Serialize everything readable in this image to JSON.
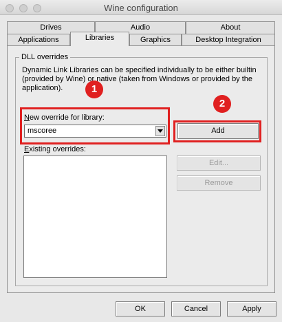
{
  "window": {
    "title": "Wine configuration"
  },
  "tabs": {
    "row_top": [
      {
        "label": "Drives"
      },
      {
        "label": "Audio"
      },
      {
        "label": "About"
      }
    ],
    "row_bottom": [
      {
        "label": "Applications"
      },
      {
        "label": "Libraries",
        "active": true
      },
      {
        "label": "Graphics"
      },
      {
        "label": "Desktop Integration"
      }
    ]
  },
  "dll_overrides": {
    "group_label": "DLL overrides",
    "description": "Dynamic Link Libraries can be specified individually to be either builtin (provided by Wine) or native (taken from Windows or provided by the application).",
    "new_override_label": "New override for library:",
    "new_override_value": "mscoree",
    "add_button": "Add",
    "existing_label": "Existing overrides:",
    "existing_items": [],
    "edit_button": "Edit...",
    "remove_button": "Remove"
  },
  "annotations": {
    "badge1": "1",
    "badge2": "2",
    "color": "#e02020"
  },
  "footer": {
    "ok_button": "OK",
    "cancel_button": "Cancel",
    "apply_button": "Apply"
  }
}
